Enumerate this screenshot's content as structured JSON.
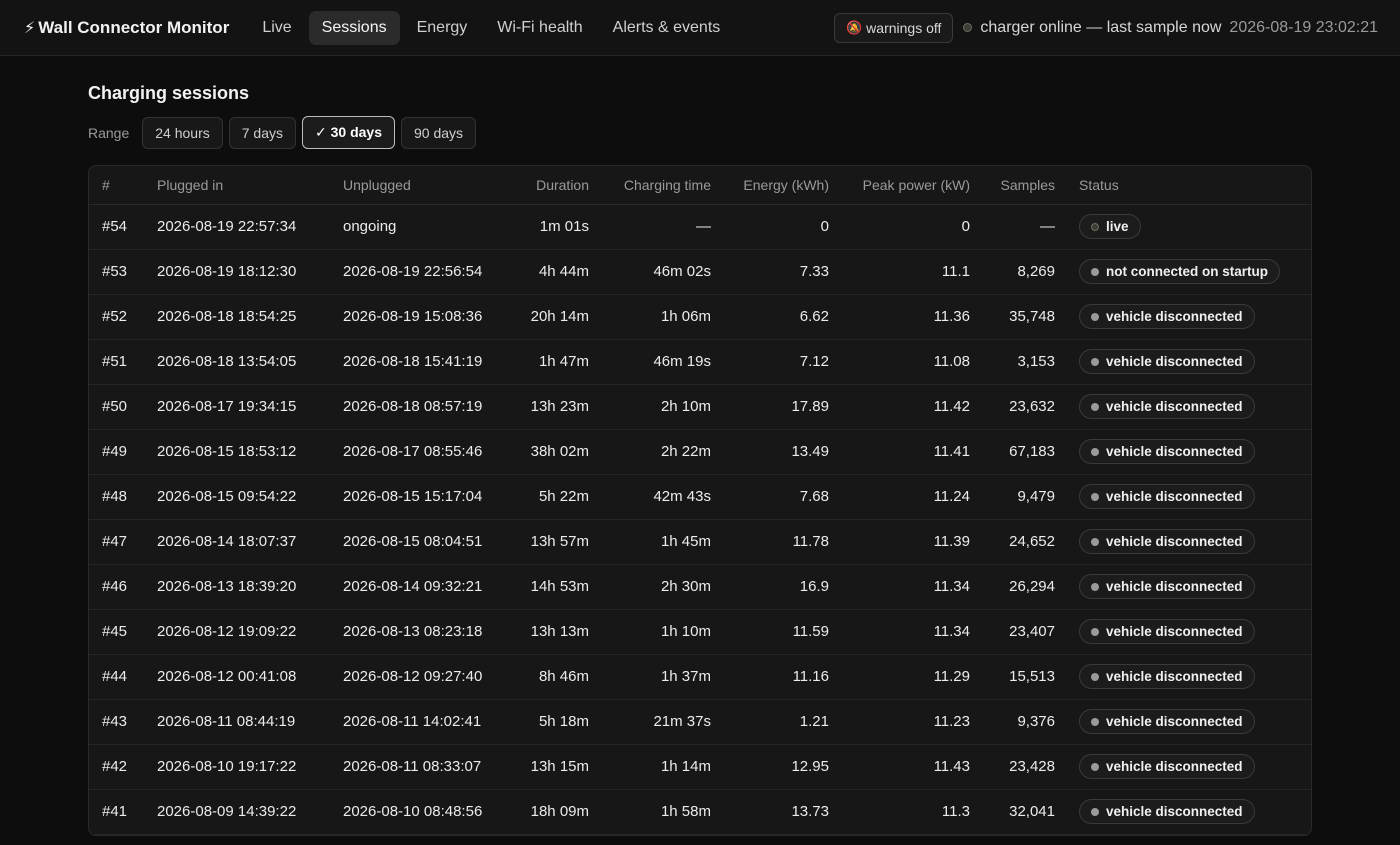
{
  "app": {
    "title": "Wall Connector Monitor",
    "brand_icon": "bolt-icon"
  },
  "nav": {
    "tabs": [
      {
        "label": "Live",
        "active": false
      },
      {
        "label": "Sessions",
        "active": true
      },
      {
        "label": "Energy",
        "active": false
      },
      {
        "label": "Wi-Fi health",
        "active": false
      },
      {
        "label": "Alerts & events",
        "active": false
      }
    ]
  },
  "header": {
    "warnings_label": "warnings off",
    "warnings_icon": "bell-muted-icon",
    "status_text": "charger online — last sample now",
    "timestamp": "2026-08-19 23:02:21"
  },
  "sessions": {
    "title": "Charging sessions",
    "range_label": "Range",
    "ranges": [
      {
        "label": "24 hours",
        "active": false
      },
      {
        "label": "7 days",
        "active": false
      },
      {
        "label": "✓ 30 days",
        "active": true
      },
      {
        "label": "90 days",
        "active": false
      }
    ],
    "columns": [
      "#",
      "Plugged in",
      "Unplugged",
      "Duration",
      "Charging time",
      "Energy (kWh)",
      "Peak power (kW)",
      "Samples",
      "Status"
    ],
    "rows": [
      {
        "id": "#54",
        "plugged": "2026-08-19 22:57:34",
        "unplugged": "ongoing",
        "duration": "1m 01s",
        "charging": "—",
        "energy": "0",
        "peak": "0",
        "samples": "—",
        "status": "live"
      },
      {
        "id": "#53",
        "plugged": "2026-08-19 18:12:30",
        "unplugged": "2026-08-19 22:56:54",
        "duration": "4h 44m",
        "charging": "46m 02s",
        "energy": "7.33",
        "peak": "11.1",
        "samples": "8,269",
        "status": "not connected on startup"
      },
      {
        "id": "#52",
        "plugged": "2026-08-18 18:54:25",
        "unplugged": "2026-08-19 15:08:36",
        "duration": "20h 14m",
        "charging": "1h 06m",
        "energy": "6.62",
        "peak": "11.36",
        "samples": "35,748",
        "status": "vehicle disconnected"
      },
      {
        "id": "#51",
        "plugged": "2026-08-18 13:54:05",
        "unplugged": "2026-08-18 15:41:19",
        "duration": "1h 47m",
        "charging": "46m 19s",
        "energy": "7.12",
        "peak": "11.08",
        "samples": "3,153",
        "status": "vehicle disconnected"
      },
      {
        "id": "#50",
        "plugged": "2026-08-17 19:34:15",
        "unplugged": "2026-08-18 08:57:19",
        "duration": "13h 23m",
        "charging": "2h 10m",
        "energy": "17.89",
        "peak": "11.42",
        "samples": "23,632",
        "status": "vehicle disconnected"
      },
      {
        "id": "#49",
        "plugged": "2026-08-15 18:53:12",
        "unplugged": "2026-08-17 08:55:46",
        "duration": "38h 02m",
        "charging": "2h 22m",
        "energy": "13.49",
        "peak": "11.41",
        "samples": "67,183",
        "status": "vehicle disconnected"
      },
      {
        "id": "#48",
        "plugged": "2026-08-15 09:54:22",
        "unplugged": "2026-08-15 15:17:04",
        "duration": "5h 22m",
        "charging": "42m 43s",
        "energy": "7.68",
        "peak": "11.24",
        "samples": "9,479",
        "status": "vehicle disconnected"
      },
      {
        "id": "#47",
        "plugged": "2026-08-14 18:07:37",
        "unplugged": "2026-08-15 08:04:51",
        "duration": "13h 57m",
        "charging": "1h 45m",
        "energy": "11.78",
        "peak": "11.39",
        "samples": "24,652",
        "status": "vehicle disconnected"
      },
      {
        "id": "#46",
        "plugged": "2026-08-13 18:39:20",
        "unplugged": "2026-08-14 09:32:21",
        "duration": "14h 53m",
        "charging": "2h 30m",
        "energy": "16.9",
        "peak": "11.34",
        "samples": "26,294",
        "status": "vehicle disconnected"
      },
      {
        "id": "#45",
        "plugged": "2026-08-12 19:09:22",
        "unplugged": "2026-08-13 08:23:18",
        "duration": "13h 13m",
        "charging": "1h 10m",
        "energy": "11.59",
        "peak": "11.34",
        "samples": "23,407",
        "status": "vehicle disconnected"
      },
      {
        "id": "#44",
        "plugged": "2026-08-12 00:41:08",
        "unplugged": "2026-08-12 09:27:40",
        "duration": "8h 46m",
        "charging": "1h 37m",
        "energy": "11.16",
        "peak": "11.29",
        "samples": "15,513",
        "status": "vehicle disconnected"
      },
      {
        "id": "#43",
        "plugged": "2026-08-11 08:44:19",
        "unplugged": "2026-08-11 14:02:41",
        "duration": "5h 18m",
        "charging": "21m 37s",
        "energy": "1.21",
        "peak": "11.23",
        "samples": "9,376",
        "status": "vehicle disconnected"
      },
      {
        "id": "#42",
        "plugged": "2026-08-10 19:17:22",
        "unplugged": "2026-08-11 08:33:07",
        "duration": "13h 15m",
        "charging": "1h 14m",
        "energy": "12.95",
        "peak": "11.43",
        "samples": "23,428",
        "status": "vehicle disconnected"
      },
      {
        "id": "#41",
        "plugged": "2026-08-09 14:39:22",
        "unplugged": "2026-08-10 08:48:56",
        "duration": "18h 09m",
        "charging": "1h 58m",
        "energy": "13.73",
        "peak": "11.3",
        "samples": "32,041",
        "status": "vehicle disconnected"
      }
    ]
  }
}
